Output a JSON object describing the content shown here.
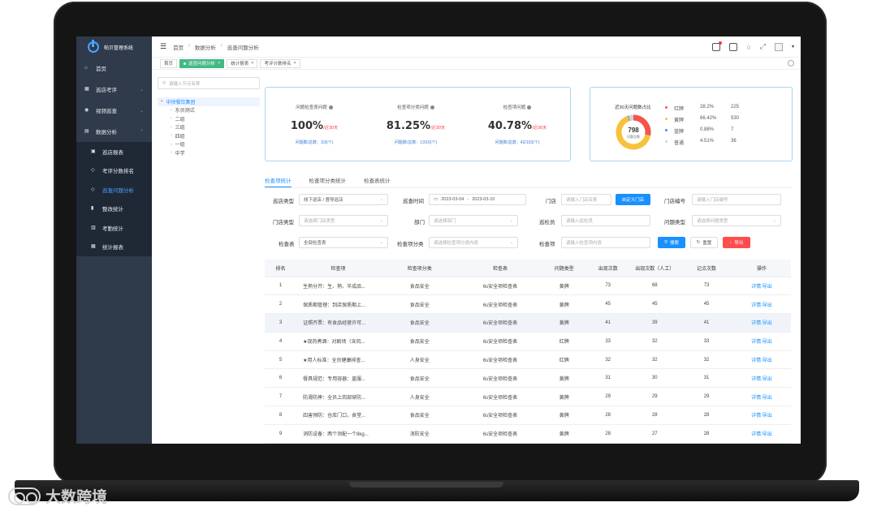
{
  "app": {
    "title": "帕贝管理系统"
  },
  "sidebar": {
    "items": [
      {
        "label": "首页",
        "icon": "home-icon"
      },
      {
        "label": "巡店考评",
        "icon": "grid-icon"
      },
      {
        "label": "视频巡查",
        "icon": "camera-icon"
      },
      {
        "label": "数据分析",
        "icon": "report-icon"
      }
    ],
    "sub_items": [
      {
        "label": "巡店报表"
      },
      {
        "label": "考评分数排名"
      },
      {
        "label": "巡查问题分析"
      },
      {
        "label": "整改统计"
      },
      {
        "label": "考勤统计"
      },
      {
        "label": "统计报表"
      }
    ]
  },
  "breadcrumb": [
    "首页",
    "数据分析",
    "巡查问题分析"
  ],
  "tags": [
    {
      "label": "首页"
    },
    {
      "label": "巡查问题分析"
    },
    {
      "label": "统计报表"
    },
    {
      "label": "考评分数排名"
    }
  ],
  "tree": {
    "search_placeholder": "请输入节点名称",
    "root": "中快餐饮集团",
    "children": [
      "东员测试",
      "二组",
      "三组",
      "四组",
      "一组",
      "中学"
    ]
  },
  "stats": [
    {
      "label": "问题检查表问题",
      "value": "100%",
      "sub": "/近30天",
      "foot": "问题数/总数：3/3(个)"
    },
    {
      "label": "检查项分类问题",
      "value": "81.25%",
      "sub": "/近30天",
      "foot": "问题数/总数：13/16(个)"
    },
    {
      "label": "检查项问题",
      "value": "40.78%",
      "sub": "/近30天",
      "foot": "问题数/总数：42/103(个)"
    }
  ],
  "donut": {
    "title": "近30天问题数占比",
    "total": "798",
    "total_label": "问题总数",
    "colors": {
      "red": "#f5554a",
      "yellow": "#f7c23b",
      "blue": "#3a8ef6",
      "gray": "#cfd3da"
    },
    "legend": [
      {
        "name": "红牌",
        "pct": "28.2%",
        "count": "225",
        "color": "#f5554a",
        "fraction": 0.282
      },
      {
        "name": "黄牌",
        "pct": "66.42%",
        "count": "530",
        "color": "#f7c23b",
        "fraction": 0.6642
      },
      {
        "name": "蓝牌",
        "pct": "0.88%",
        "count": "7",
        "color": "#3a8ef6",
        "fraction": 0.0088
      },
      {
        "name": "普通",
        "pct": "4.51%",
        "count": "36",
        "color": "#cfd3da",
        "fraction": 0.0451
      }
    ]
  },
  "tabs": [
    "检查项统计",
    "检查项分类统计",
    "检查表统计"
  ],
  "form": {
    "type_label": "巡店类型",
    "type_value": "线下巡店 / 督导巡店",
    "time_label": "巡查时间",
    "time_start": "2023-03-04",
    "time_sep": "-",
    "time_end": "2023-03-10",
    "store_label": "门店",
    "store_placeholder": "请输入门店名称",
    "store_btn": "自定义门店",
    "storeno_label": "门店编号",
    "storeno_placeholder": "请输入门店编号",
    "storetype_label": "门店类型",
    "storetype_placeholder": "请选择门店类型",
    "dept_label": "部门",
    "dept_placeholder": "请选择部门",
    "inspector_label": "巡检员",
    "inspector_placeholder": "请输入巡检员",
    "issuetype_label": "问题类型",
    "issuetype_placeholder": "请选择问题类型",
    "sheet_label": "检查表",
    "sheet_value": "全部检查表",
    "cat_label": "检查项分类",
    "cat_placeholder": "请选择检查项分类内容",
    "item_label": "检查项",
    "item_placeholder": "请输入检查项内容",
    "search_btn": "搜索",
    "reset_btn": "重置",
    "export_btn": "导出"
  },
  "table": {
    "headers": [
      "排名",
      "检查项",
      "检查项分类",
      "检查表",
      "问题类型",
      "出现次数",
      "出现次数（人工）",
      "记点次数",
      "操作"
    ],
    "rows": [
      [
        "1",
        "生熟分开：生、熟、半成品...",
        "食品安全",
        "6s安全项检查表",
        "黄牌",
        "73",
        "68",
        "73"
      ],
      [
        "2",
        "保质期管理：到店保质期上...",
        "食品安全",
        "6s安全项检查表",
        "黄牌",
        "45",
        "45",
        "45"
      ],
      [
        "3",
        "证照齐票：有食品经营许可...",
        "食品安全",
        "6s安全项检查表",
        "黄牌",
        "41",
        "39",
        "41"
      ],
      [
        "4",
        "★现热煮酒：对剧场（含风...",
        "食品安全",
        "6s安全项检查表",
        "红牌",
        "33",
        "32",
        "33"
      ],
      [
        "5",
        "★用人标准：全员健康排查...",
        "人身安全",
        "6s安全项检查表",
        "红牌",
        "32",
        "32",
        "32"
      ],
      [
        "6",
        "餐具规范：专用容器：盖服...",
        "食品安全",
        "6s安全项检查表",
        "黄牌",
        "31",
        "30",
        "31"
      ],
      [
        "7",
        "防滑防摔：全员上岗部穿防...",
        "人身安全",
        "6s安全项检查表",
        "黄牌",
        "29",
        "29",
        "29"
      ],
      [
        "8",
        "四害预防：仓库门口，食堂...",
        "食品安全",
        "6s安全项检查表",
        "黄牌",
        "28",
        "28",
        "28"
      ],
      [
        "9",
        "消防设备：两个须配一个8kg...",
        "消防安全",
        "6s安全项检查表",
        "黄牌",
        "28",
        "27",
        "28"
      ]
    ],
    "op_detail": "详情",
    "op_sep": "|",
    "op_export": "导出"
  },
  "watermark": "大数跨境"
}
